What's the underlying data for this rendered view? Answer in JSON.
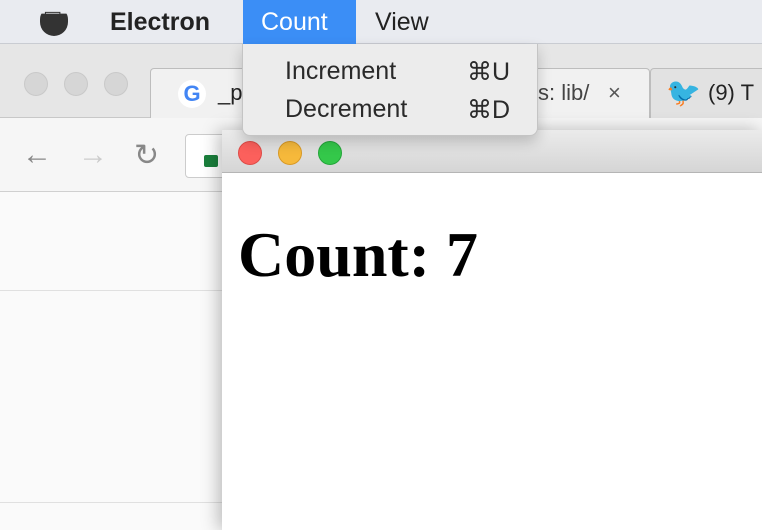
{
  "menubar": {
    "app": "Electron",
    "menus": [
      "Count",
      "View"
    ],
    "active_menu": "Count",
    "accent": "#3b8ef6"
  },
  "count_menu": {
    "items": [
      {
        "label": "Increment",
        "shortcut": "⌘U"
      },
      {
        "label": "Decrement",
        "shortcut": "⌘D"
      }
    ]
  },
  "browser": {
    "tabs": [
      {
        "title": "_p",
        "icon": "google-icon"
      },
      {
        "title": "s: lib/",
        "icon": "",
        "close": "×"
      },
      {
        "title": "(9) T",
        "icon": "twitter-icon"
      }
    ]
  },
  "electron_window": {
    "heading": "Count: 7"
  }
}
